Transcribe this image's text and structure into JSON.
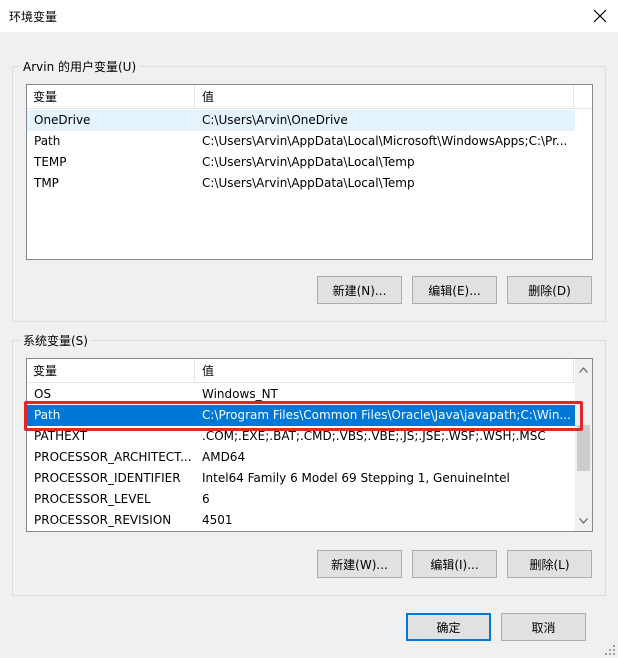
{
  "window": {
    "title": "环境变量",
    "close_icon": "close-icon"
  },
  "user_vars": {
    "group_label": "Arvin 的用户变量(U)",
    "columns": [
      "变量",
      "值"
    ],
    "rows": [
      {
        "name": "OneDrive",
        "value": "C:\\Users\\Arvin\\OneDrive"
      },
      {
        "name": "Path",
        "value": "C:\\Users\\Arvin\\AppData\\Local\\Microsoft\\WindowsApps;C:\\Pr..."
      },
      {
        "name": "TEMP",
        "value": "C:\\Users\\Arvin\\AppData\\Local\\Temp"
      },
      {
        "name": "TMP",
        "value": "C:\\Users\\Arvin\\AppData\\Local\\Temp"
      }
    ],
    "buttons": {
      "new": "新建(N)...",
      "edit": "编辑(E)...",
      "delete": "删除(D)"
    }
  },
  "system_vars": {
    "group_label": "系统变量(S)",
    "columns": [
      "变量",
      "值"
    ],
    "rows": [
      {
        "name": "OS",
        "value": "Windows_NT"
      },
      {
        "name": "Path",
        "value": "C:\\Program Files\\Common Files\\Oracle\\Java\\javapath;C:\\Win..."
      },
      {
        "name": "PATHEXT",
        "value": ".COM;.EXE;.BAT;.CMD;.VBS;.VBE;.JS;.JSE;.WSF;.WSH;.MSC"
      },
      {
        "name": "PROCESSOR_ARCHITECT...",
        "value": "AMD64"
      },
      {
        "name": "PROCESSOR_IDENTIFIER",
        "value": "Intel64 Family 6 Model 69 Stepping 1, GenuineIntel"
      },
      {
        "name": "PROCESSOR_LEVEL",
        "value": "6"
      },
      {
        "name": "PROCESSOR_REVISION",
        "value": "4501"
      }
    ],
    "selected_row": "Path",
    "buttons": {
      "new": "新建(W)...",
      "edit": "编辑(I)...",
      "delete": "删除(L)"
    }
  },
  "footer": {
    "ok": "确定",
    "cancel": "取消"
  },
  "colors": {
    "selection": "#0078d7",
    "hover": "#e5f3ff",
    "highlight": "#e0282a"
  }
}
